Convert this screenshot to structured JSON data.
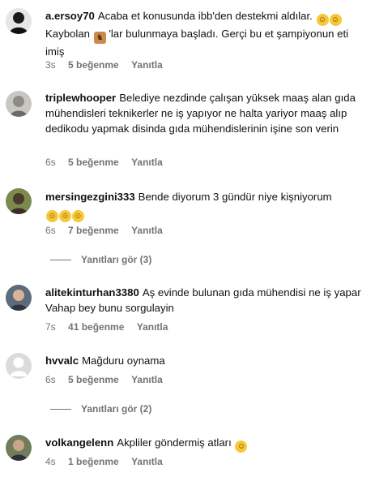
{
  "comments": [
    {
      "user": "a.ersoy70",
      "text_parts": [
        "Acaba et konusunda ibb'den destekmi aldılar. ",
        " ",
        "\nKaybolan ",
        " 'lar bulunmaya başladı. Gerçi bu et şampiyonun eti imiş"
      ],
      "text_a": "Acaba et konusunda ibb'den destekmi aldılar.",
      "text_b": "Kaybolan",
      "text_c": "'lar bulunmaya başladı. Gerçi bu et şampiyonun eti imiş",
      "time": "3s",
      "likes": "5 beğenme",
      "reply": "Yanıtla"
    },
    {
      "user": "triplewhooper",
      "text": "Belediye nezdinde çalışan yüksek maaş alan gıda mühendisleri teknikerler ne iş yapıyor ne halta yariyor maaş alıp dedikodu yapmak disinda gıda mühendislerinin işine son verin",
      "time": "6s",
      "likes": "5 beğenme",
      "reply": "Yanıtla"
    },
    {
      "user": "mersingezgini333",
      "text": "Bende diyorum 3 gündür niye kişniyorum",
      "time": "6s",
      "likes": "7 beğenme",
      "reply": "Yanıtla",
      "view_replies": "Yanıtları gör (3)"
    },
    {
      "user": "alitekinturhan3380",
      "text": "Aş evinde bulunan gıda mühendisi ne iş yapar Vahap bey bunu sorgulayin",
      "time": "7s",
      "likes": "41 beğenme",
      "reply": "Yanıtla"
    },
    {
      "user": "hvvalc",
      "text": "Mağduru oynama",
      "time": "6s",
      "likes": "5 beğenme",
      "reply": "Yanıtla",
      "view_replies": "Yanıtları gör (2)"
    },
    {
      "user": "volkangelenn",
      "text": "Akpliler göndermiş atları",
      "time": "4s",
      "likes": "1 beğenme",
      "reply": "Yanıtla"
    }
  ],
  "icons": {
    "laugh_emoji": "grinning-sweat-emoji",
    "horse_emoji": "horse-face-emoji",
    "grin_emoji": "grinning-face-emoji"
  },
  "colors": {
    "meta_text": "#737373",
    "emoji_yellow": "#f7c836"
  }
}
